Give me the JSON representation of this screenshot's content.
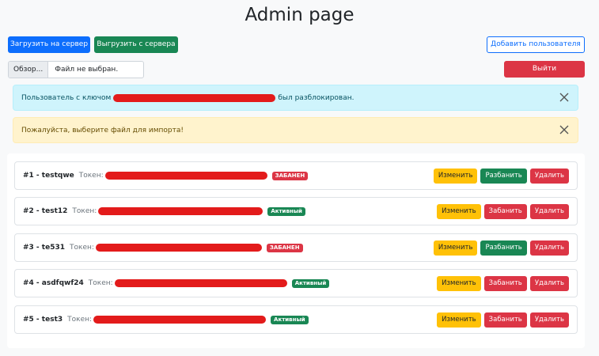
{
  "header": {
    "title": "Admin page"
  },
  "toolbar": {
    "upload_label": "Загрузить на сервер",
    "download_label": "Выгрузить с сервера",
    "add_user_label": "Добавить пользователя",
    "logout_label": "Выйти"
  },
  "file_input": {
    "browse_label": "Обзор...",
    "status": "Файл не выбран."
  },
  "alerts": {
    "info_prefix": "Пользователь с ключом",
    "info_suffix": "был разблокирован.",
    "warning_text": "Пожалуйста, выберите файл для импорта!"
  },
  "users": [
    {
      "title": "#1 - testqwe",
      "token_label": "Токен:",
      "status": "ЗАБАНЕН",
      "status_color": "#dc3545",
      "toggle_label": "Разбанить",
      "toggle_color": "#198754"
    },
    {
      "title": "#2 - test12",
      "token_label": "Токен:",
      "status": "Активный",
      "status_color": "#198754",
      "toggle_label": "Забанить",
      "toggle_color": "#dc3545"
    },
    {
      "title": "#3 - te531",
      "token_label": "Токен:",
      "status": "ЗАБАНЕН",
      "status_color": "#dc3545",
      "toggle_label": "Разбанить",
      "toggle_color": "#198754"
    },
    {
      "title": "#4 - asdfqwf24",
      "token_label": "Токен:",
      "status": "Активный",
      "status_color": "#198754",
      "toggle_label": "Забанить",
      "toggle_color": "#dc3545"
    },
    {
      "title": "#5 - test3",
      "token_label": "Токен:",
      "status": "Активный",
      "status_color": "#198754",
      "toggle_label": "Забанить",
      "toggle_color": "#dc3545"
    }
  ],
  "row_actions": {
    "edit_label": "Изменить",
    "delete_label": "Удалить"
  },
  "colors": {
    "primary": "#0d6efd",
    "success": "#198754",
    "danger": "#dc3545",
    "warning": "#ffc107",
    "redaction": "#e31b1b"
  }
}
